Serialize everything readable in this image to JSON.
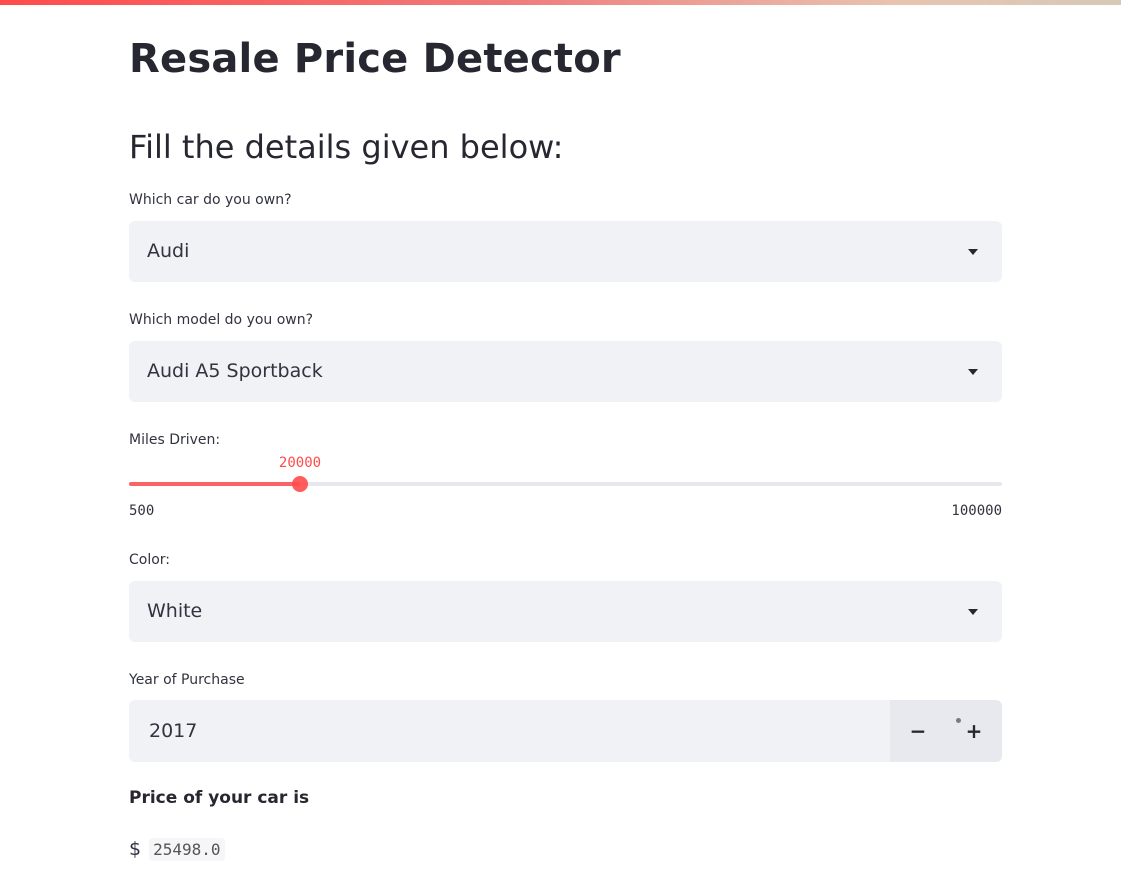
{
  "app": {
    "title": "Resale Price Detector",
    "subheader": "Fill the details given below:"
  },
  "colors": {
    "accent": "#ff4b4b",
    "input_bg": "#f0f2f6",
    "text": "#262730"
  },
  "car_select": {
    "label": "Which car do you own?",
    "value": "Audi",
    "icon": "chevron-down-icon"
  },
  "model_select": {
    "label": "Which model do you own?",
    "value": "Audi A5 Sportback",
    "icon": "chevron-down-icon"
  },
  "miles_slider": {
    "label": "Miles Driven:",
    "value": 20000,
    "value_text": "20000",
    "min": 500,
    "min_text": "500",
    "max": 100000,
    "max_text": "100000"
  },
  "color_select": {
    "label": "Color:",
    "value": "White",
    "icon": "chevron-down-icon"
  },
  "year_input": {
    "label": "Year of Purchase",
    "value": "2017",
    "minus": "−",
    "plus": "+"
  },
  "result": {
    "label": "Price of your car is",
    "currency": "$",
    "price": "25498.0"
  }
}
